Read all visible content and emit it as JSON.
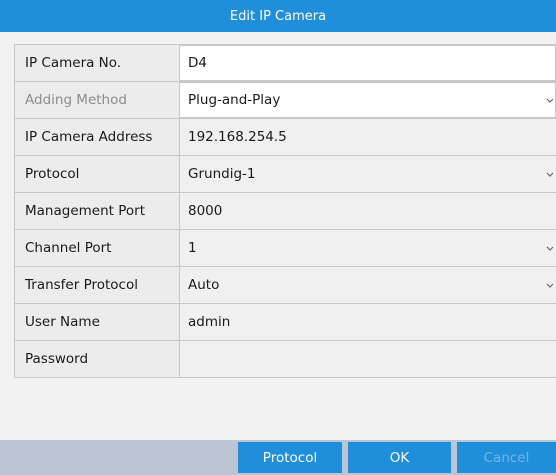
{
  "dialog": {
    "title": "Edit IP Camera"
  },
  "fields": [
    {
      "label": "IP Camera No.",
      "value": "D4"
    },
    {
      "label": "Adding Method",
      "value": "Plug-and-Play"
    },
    {
      "label": "IP Camera Address",
      "value": "192.168.254.5"
    },
    {
      "label": "Protocol",
      "value": "Grundig-1"
    },
    {
      "label": "Management Port",
      "value": "8000"
    },
    {
      "label": "Channel Port",
      "value": "1"
    },
    {
      "label": "Transfer Protocol",
      "value": "Auto"
    },
    {
      "label": "User Name",
      "value": "admin"
    },
    {
      "label": "Password",
      "value": ""
    }
  ],
  "buttons": {
    "protocol": "Protocol",
    "ok": "OK",
    "cancel": "Cancel"
  },
  "icons": {
    "dropdown": "chevron-down-icon"
  },
  "colors": {
    "accent": "#1f8fdc",
    "footer": "#bcc5d3",
    "disabled_text": "#8c8c8c"
  }
}
